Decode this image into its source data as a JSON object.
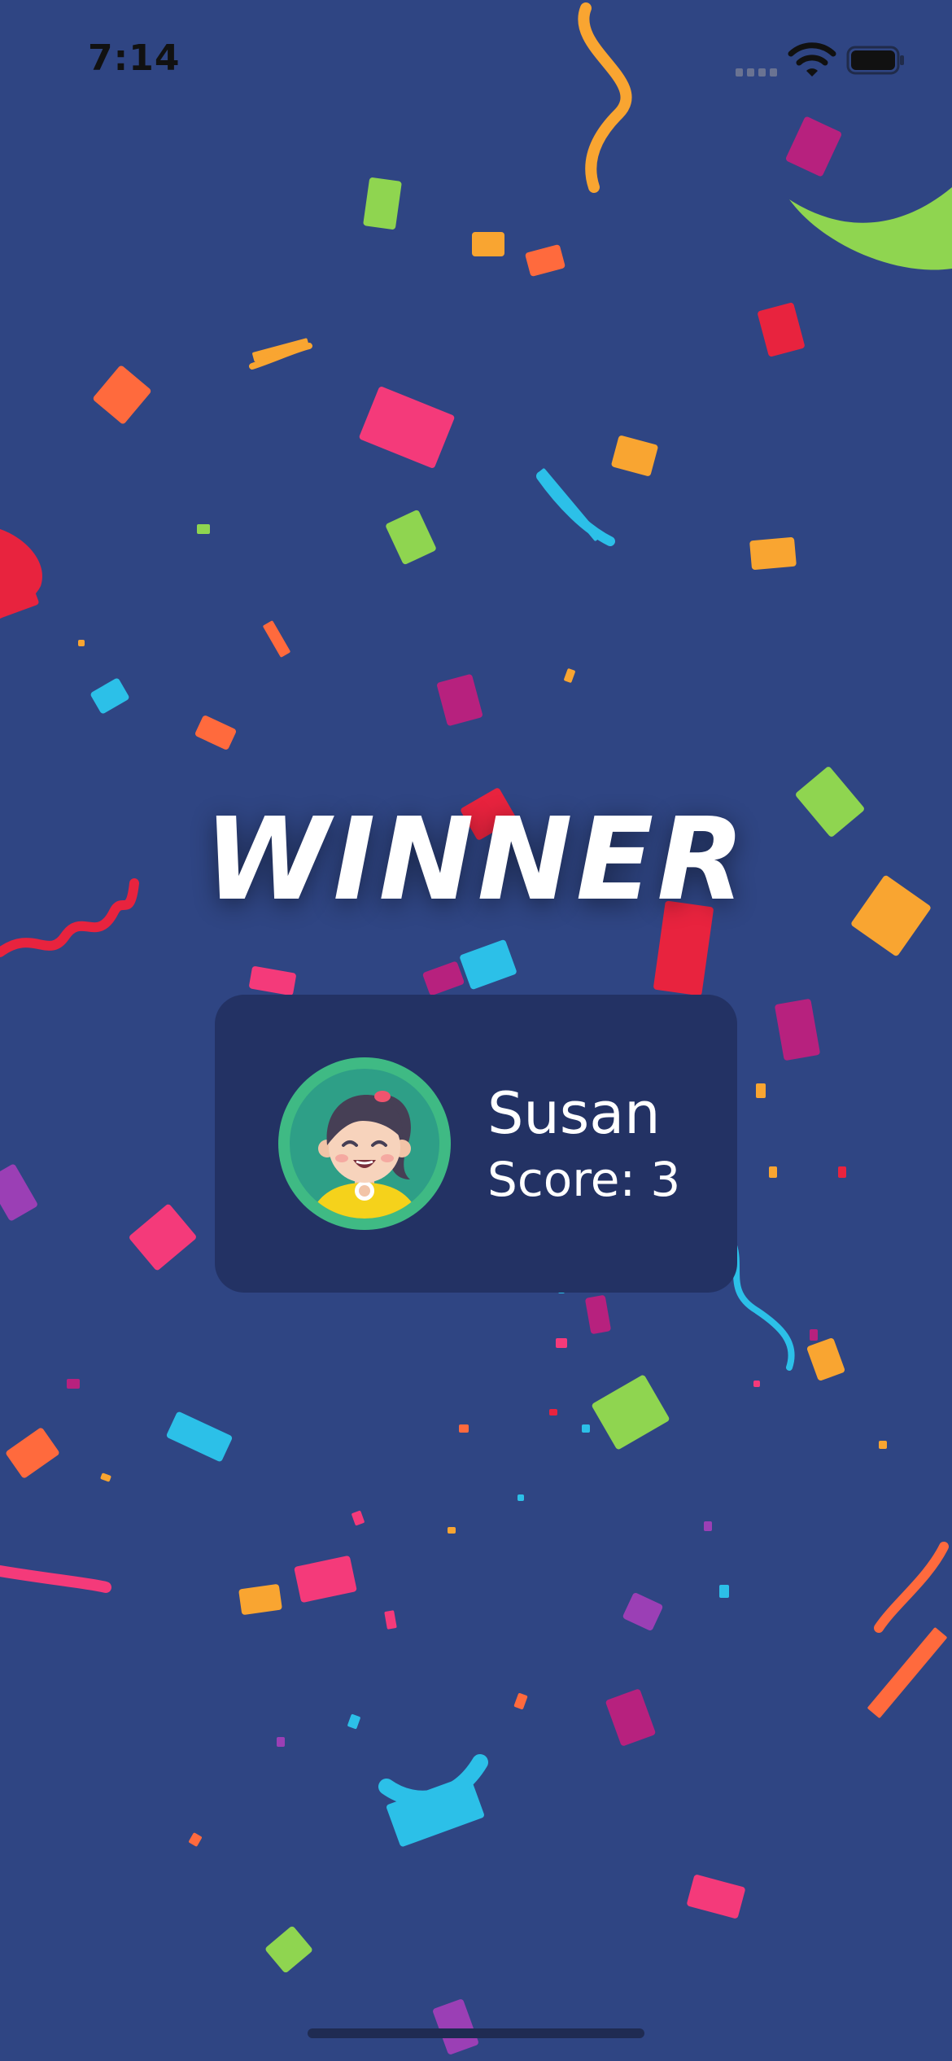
{
  "status_bar": {
    "time": "7:14"
  },
  "title": "WINNER",
  "winner_card": {
    "name": "Susan",
    "score_text": "Score: 3"
  },
  "icons": [
    "cellular-signal-icon",
    "wifi-icon",
    "battery-icon",
    "girl-avatar-icon"
  ],
  "colors": {
    "background": "#2f4583",
    "card": "#233264",
    "avatar_ring": "#3fba84",
    "avatar_inner": "#2e9f87",
    "shirt": "#f5d21b",
    "confetti": [
      "#f43a7a",
      "#f9a531",
      "#8fd550",
      "#2cc0e8",
      "#b7217e",
      "#e8233e",
      "#ff6a3d",
      "#9b3fb5"
    ]
  }
}
